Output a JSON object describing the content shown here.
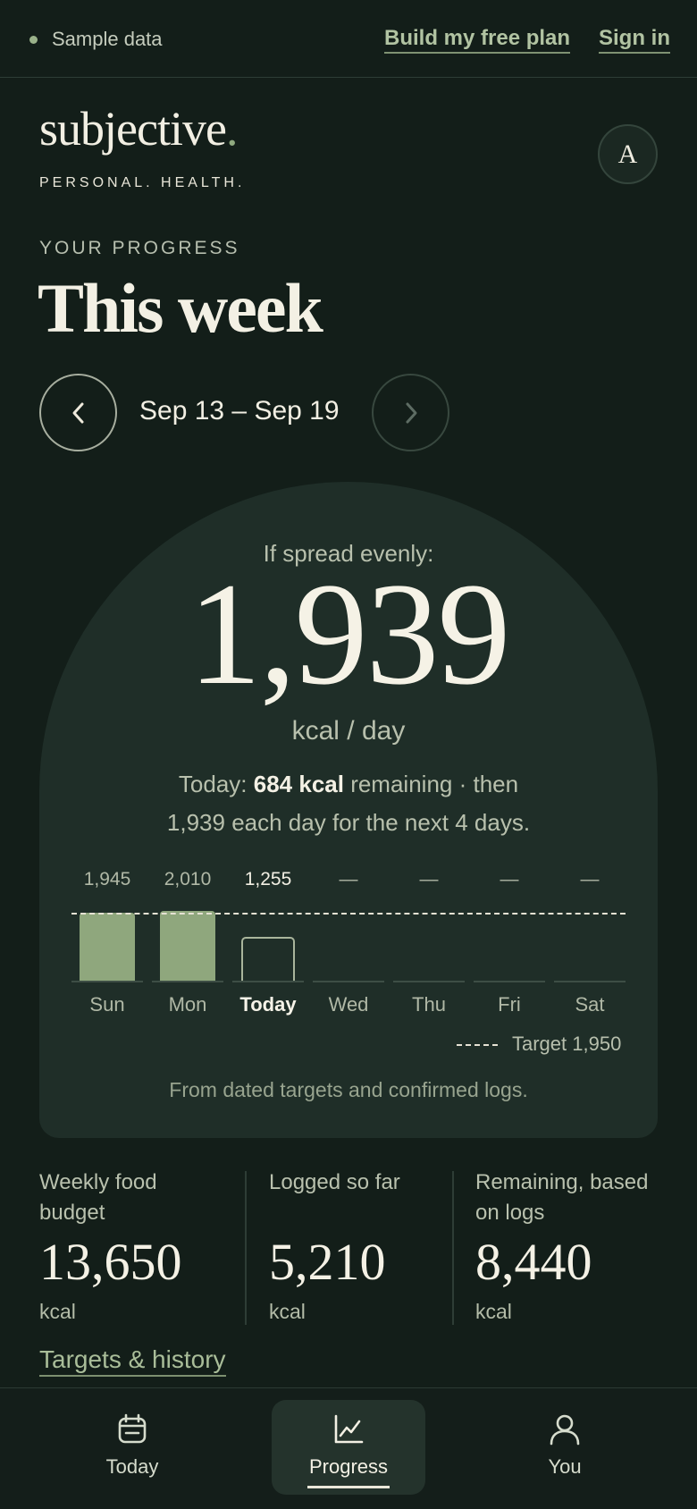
{
  "topbar": {
    "sample_label": "Sample data",
    "build_plan": "Build my free plan",
    "sign_in": "Sign in"
  },
  "brand": {
    "logo": "subjective",
    "logo_dot": ".",
    "tagline": "PERSONAL. HEALTH.",
    "avatar_initial": "A"
  },
  "progress": {
    "eyebrow": "YOUR PROGRESS",
    "title": "This week",
    "week_range": "Sep 13 – Sep 19",
    "prev_icon": "chevron-left-icon",
    "next_icon": "chevron-right-icon"
  },
  "card": {
    "label": "If spread evenly:",
    "big_number": "1,939",
    "unit": "kcal / day",
    "summary_prefix": "Today: ",
    "summary_strong": "684 kcal",
    "summary_suffix": " remaining · then",
    "summary_line2": "1,939 each day for the next 4 days.",
    "legend": "Target 1,950",
    "footnote": "From dated targets and confirmed logs."
  },
  "chart_data": {
    "type": "bar",
    "categories": [
      "Sun",
      "Mon",
      "Today",
      "Wed",
      "Thu",
      "Fri",
      "Sat"
    ],
    "values": [
      1945,
      2010,
      1255,
      null,
      null,
      null,
      null
    ],
    "value_labels": [
      "1,945",
      "2,010",
      "1,255",
      "—",
      "—",
      "—",
      "—"
    ],
    "target": 1950,
    "current_index": 2,
    "colors": {
      "filled": "#8fa77d",
      "target": "#e6e2d4"
    }
  },
  "stats": [
    {
      "label": "Weekly food budget",
      "value": "13,650",
      "unit": "kcal"
    },
    {
      "label": "Logged so far",
      "value": "5,210",
      "unit": "kcal"
    },
    {
      "label": "Remaining, based on logs",
      "value": "8,440",
      "unit": "kcal"
    }
  ],
  "history_link": "Targets & history",
  "bottom_nav": {
    "tabs": [
      {
        "label": "Today",
        "icon": "calendar-icon",
        "active": false
      },
      {
        "label": "Progress",
        "icon": "chart-line-icon",
        "active": true
      },
      {
        "label": "You",
        "icon": "user-icon",
        "active": false
      }
    ]
  },
  "colors": {
    "background": "#131e19",
    "card": "#1f2e28",
    "accent": "#8fa77d"
  }
}
